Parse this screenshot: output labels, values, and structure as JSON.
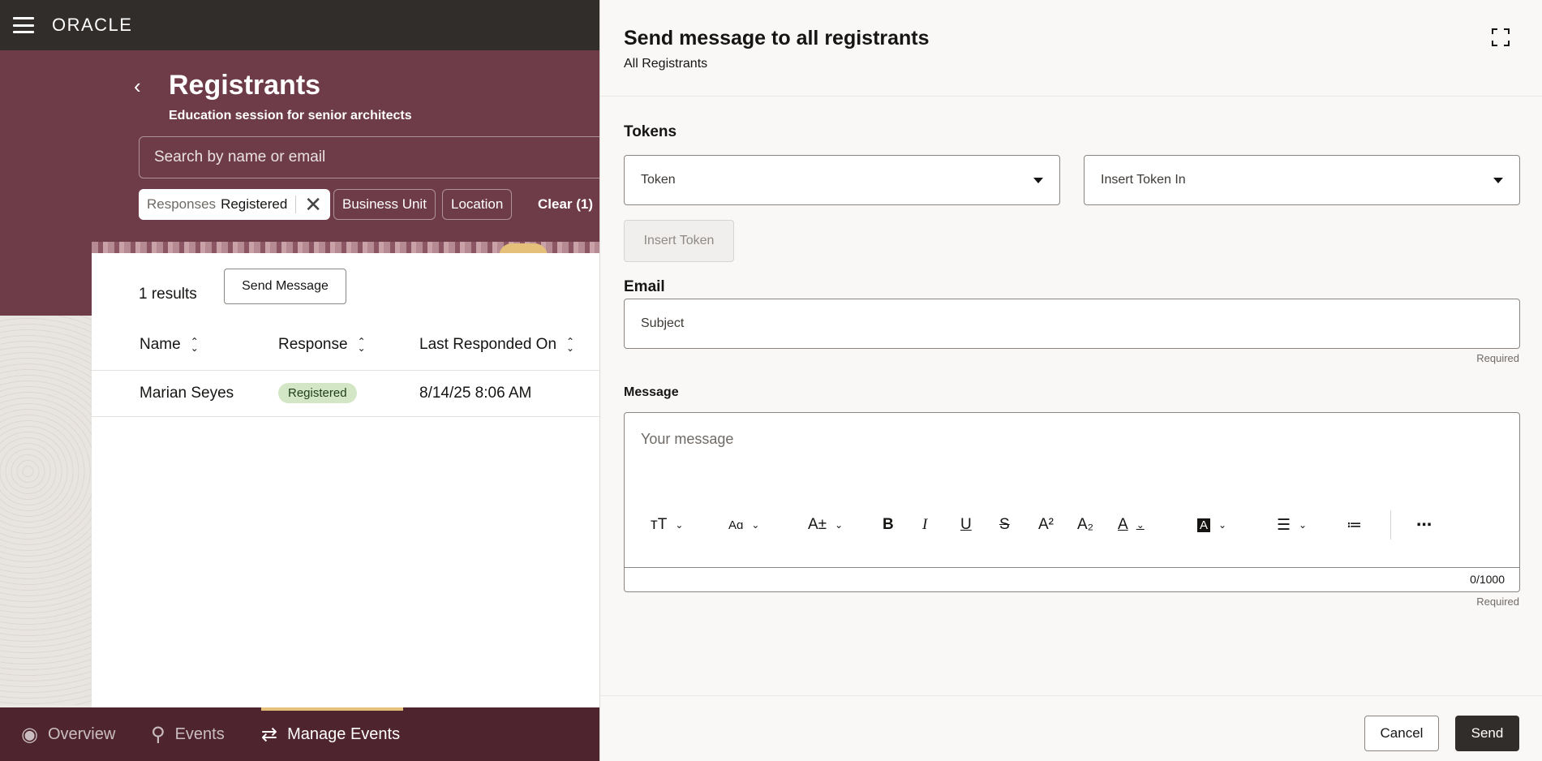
{
  "topbar": {
    "logo": "ORACLE"
  },
  "page": {
    "title": "Registrants",
    "subtitle": "Education session for senior architects",
    "search_placeholder": "Search by name or email"
  },
  "filters": {
    "active_key": "Responses",
    "active_value": "Registered",
    "business_unit": "Business Unit",
    "location": "Location",
    "clear": "Clear (1)"
  },
  "results": {
    "count_label": "1 results",
    "send_message": "Send Message",
    "columns": [
      "Name",
      "Response",
      "Last Responded On"
    ],
    "rows": [
      {
        "name": "Marian Seyes",
        "response": "Registered",
        "last_responded": "8/14/25 8:06 AM"
      }
    ]
  },
  "bottom_nav": {
    "items": [
      {
        "label": "Overview",
        "icon": "eye-icon"
      },
      {
        "label": "Events",
        "icon": "search-icon"
      },
      {
        "label": "Manage Events",
        "icon": "manage-events-icon",
        "active": true
      }
    ],
    "active_color": "#e4c07a"
  },
  "drawer": {
    "title": "Send message to all registrants",
    "subtitle": "All Registrants",
    "tokens_label": "Tokens",
    "token_select": "Token",
    "insert_token_in_select": "Insert Token In",
    "insert_token_button": "Insert Token",
    "email_label": "Email",
    "subject_placeholder": "Subject",
    "required": "Required",
    "message_label": "Message",
    "message_placeholder": "Your message",
    "counter": "0/1000",
    "cancel": "Cancel",
    "send": "Send"
  },
  "colors": {
    "banner": "#6e3b48",
    "topbar": "#312d2a",
    "bottombar": "#4e242f",
    "badge": "#d3e6c6"
  }
}
